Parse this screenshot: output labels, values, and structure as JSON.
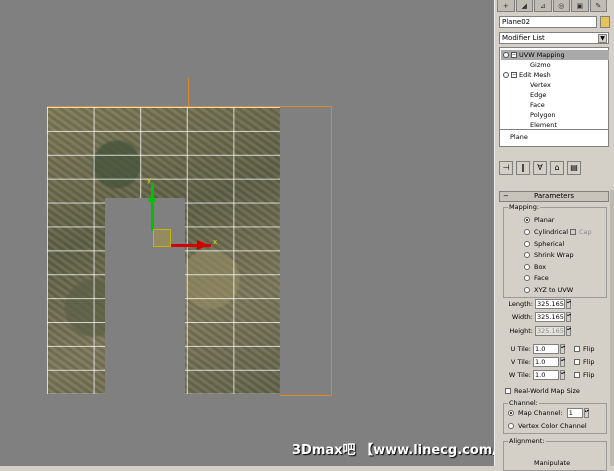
{
  "viewport": {
    "watermark": "3Dmax吧 【www.linecg.com/tieba/171】",
    "axis_x_label": "x",
    "axis_y_label": "y"
  },
  "panel": {
    "tabs": [
      "+",
      "◢",
      "⊿",
      "◎",
      "▣",
      "✎"
    ],
    "object_name": "Plane02",
    "object_color": "#e6c45a",
    "modifier_list": "Modifier List",
    "stack": [
      {
        "label": "UVW Mapping",
        "level": 0,
        "selected": true
      },
      {
        "label": "Gizmo",
        "level": 1,
        "selected": false
      },
      {
        "label": "Edit Mesh",
        "level": 0,
        "selected": false
      },
      {
        "label": "Vertex",
        "level": 1,
        "selected": false
      },
      {
        "label": "Edge",
        "level": 1,
        "selected": false
      },
      {
        "label": "Face",
        "level": 1,
        "selected": false
      },
      {
        "label": "Polygon",
        "level": 1,
        "selected": false
      },
      {
        "label": "Element",
        "level": 1,
        "selected": false
      },
      {
        "label": "Plane",
        "level": 0,
        "selected": false
      }
    ],
    "tool_icons": [
      "pin-stack-icon",
      "show-end-result-icon",
      "make-unique-icon",
      "remove-modifier-icon",
      "configure-sets-icon"
    ],
    "rollout_title": "Parameters",
    "mapping": {
      "group_title": "Mapping:",
      "options": [
        "Planar",
        "Cylindrical",
        "Spherical",
        "Shrink Wrap",
        "Box",
        "Face",
        "XYZ to UVW"
      ],
      "selected": "Planar",
      "cap_label": "Cap"
    },
    "dimensions": {
      "length_label": "Length:",
      "length_value": "325.165",
      "width_label": "Width:",
      "width_value": "325.165",
      "height_label": "Height:",
      "height_value": "325.165"
    },
    "tiles": {
      "u_label": "U Tile:",
      "u_value": "1.0",
      "v_label": "V Tile:",
      "v_value": "1.0",
      "w_label": "W Tile:",
      "w_value": "1.0",
      "flip_label": "Flip"
    },
    "real_world_label": "Real-World Map Size",
    "channel": {
      "group_title": "Channel:",
      "map_channel_label": "Map Channel:",
      "map_channel_value": "1",
      "vertex_color_label": "Vertex Color Channel"
    },
    "alignment_title": "Alignment:",
    "manipulate_label": "Manipulate"
  }
}
